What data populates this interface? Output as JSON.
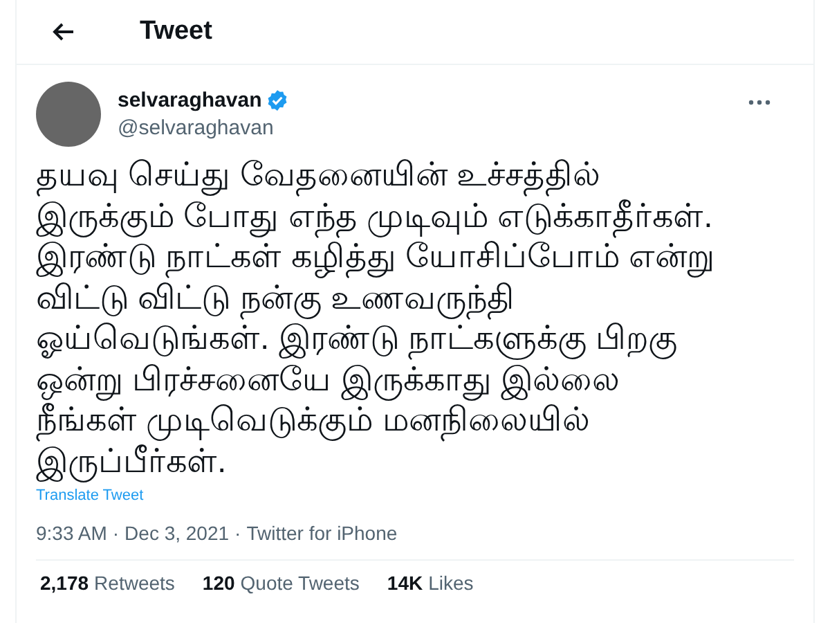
{
  "header": {
    "title": "Tweet"
  },
  "author": {
    "name": "selvaraghavan",
    "verified": true,
    "handle": "@selvaraghavan"
  },
  "tweet": {
    "text": "தயவு செய்து வேதனையின் உச்சத்தில்\nஇருக்கும் போது எந்த முடிவும் எடுக்காதீர்கள்.\nஇரண்டு நாட்கள் கழித்து யோசிப்போம் என்று\nவிட்டு விட்டு நன்கு உணவருந்தி\nஓய்வெடுங்கள். இரண்டு நாட்களுக்கு பிறகு\nஒன்று பிரச்சனையே இருக்காது இல்லை\nநீங்கள் முடிவெடுக்கும் மனநிலையில்\nஇருப்பீர்கள்.",
    "translate": "Translate Tweet"
  },
  "meta": {
    "time": "9:33 AM",
    "separator_1": "·",
    "date": "Dec 3, 2021",
    "separator_2": "·",
    "source": "Twitter for iPhone"
  },
  "stats": [
    {
      "count": "2,178",
      "label": "Retweets"
    },
    {
      "count": "120",
      "label": "Quote Tweets"
    },
    {
      "count": "14K",
      "label": "Likes"
    }
  ]
}
